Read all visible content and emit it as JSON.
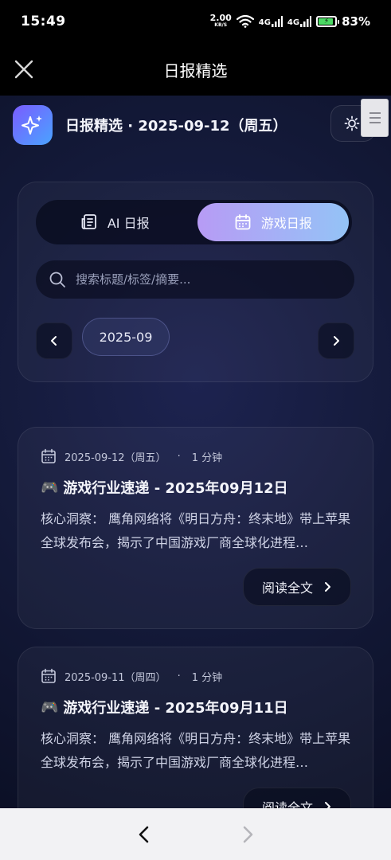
{
  "status_bar": {
    "time": "15:49",
    "net_speed_value": "2.00",
    "net_speed_unit": "KB/S",
    "signal_1": "4G",
    "signal_2": "4G",
    "battery": "83%"
  },
  "title_bar": {
    "title": "日报精选",
    "close_icon": "close-icon"
  },
  "header": {
    "title": "日报精选 · 2025-09-12（周五）",
    "logo_icon": "sparkle-icon",
    "theme_icon": "sun-icon"
  },
  "tabs": [
    {
      "label": "AI 日报",
      "icon": "newspaper-icon",
      "active": false
    },
    {
      "label": "游戏日报",
      "icon": "calendar-icon",
      "active": true
    }
  ],
  "search": {
    "placeholder": "搜索标题/标签/摘要...",
    "value": ""
  },
  "month_nav": {
    "current": "2025-09"
  },
  "articles": [
    {
      "date": "2025-09-12（周五）",
      "read_time": "1 分钟",
      "title_emoji": "🎮",
      "title": "游戏行业速递 - 2025年09月12日",
      "summary": "核心洞察： 鹰角网络将《明日方舟：终末地》带上苹果全球发布会，揭示了中国游戏厂商全球化进程…",
      "button": "阅读全文"
    },
    {
      "date": "2025-09-11（周四）",
      "read_time": "1 分钟",
      "title_emoji": "🎮",
      "title": "游戏行业速递 - 2025年09月11日",
      "summary": "核心洞察： 鹰角网络将《明日方舟：终末地》带上苹果全球发布会，揭示了中国游戏厂商全球化进程…",
      "button": "阅读全文"
    }
  ],
  "colors": {
    "accent_gradient_start": "#b79bf5",
    "accent_gradient_end": "#94c3f6",
    "logo_gradient_start": "#7a5cff",
    "logo_gradient_end": "#4aa3ff",
    "battery_green": "#4cd964"
  }
}
